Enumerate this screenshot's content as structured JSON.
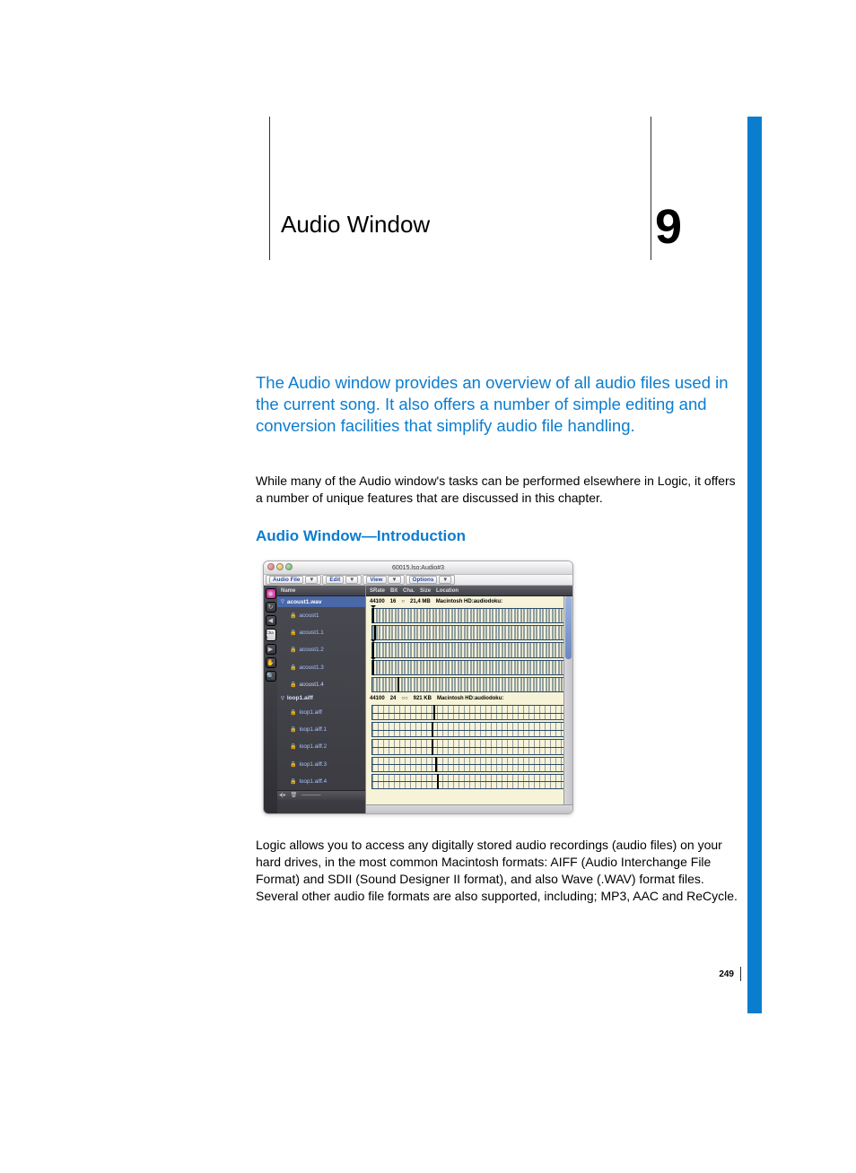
{
  "chapter": {
    "title": "Audio Window",
    "number": "9"
  },
  "intro": "The Audio window provides an overview of all audio files used in the current song. It also offers a number of simple editing and conversion facilities that simplify audio file handling.",
  "body1": "While many of the Audio window's tasks can be performed elsewhere in Logic, it offers a number of unique features that are discussed in this chapter.",
  "section_title": "Audio Window—Introduction",
  "body2": "Logic allows you to access any digitally stored audio recordings (audio files) on your hard drives, in the most common Macintosh formats:  AIFF (Audio Interchange File Format) and SDII (Sound Designer II format), and also Wave (.WAV) format files. Several other audio file formats are also supported, including; MP3, AAC and ReCycle.",
  "page_number": "249",
  "figure": {
    "window_title": "60015.lso:Audio#3",
    "menu": [
      "Audio File",
      "Edit",
      "View",
      "Options"
    ],
    "list_header": "Name",
    "wave_header": [
      "SRate",
      "Bit",
      "Cha.",
      "Size",
      "Location"
    ],
    "tool_cha": "Cha\n1",
    "files": [
      {
        "name": "acoust1.wav",
        "selected": true,
        "srate": "44100",
        "bit": "16",
        "size": "21,4 MB",
        "location": "Macintosh HD:audiodoku:",
        "regions": [
          "acoust1",
          "acoust1.1",
          "acoust1.2",
          "acoust1.3",
          "acoust1.4"
        ]
      },
      {
        "name": "loop1.aiff",
        "selected": false,
        "srate": "44100",
        "bit": "24",
        "size": "921 KB",
        "location": "Macintosh HD:audiodoku:",
        "regions": [
          "loop1.aiff",
          "loop1.aiff.1",
          "loop1.aiff.2",
          "loop1.aiff.3",
          "loop1.aiff.4"
        ]
      }
    ]
  }
}
